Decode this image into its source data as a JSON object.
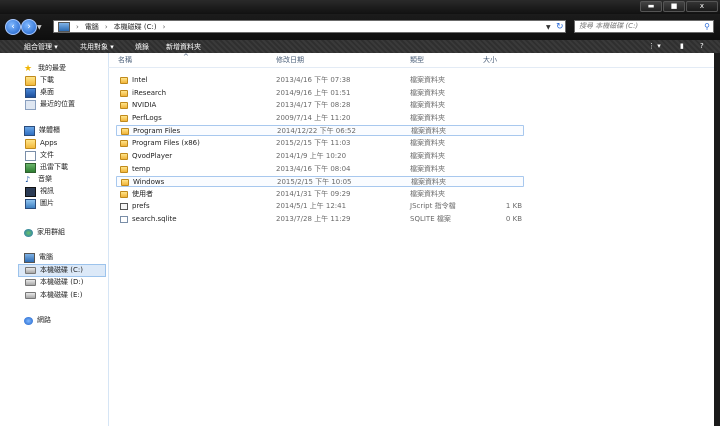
{
  "window": {
    "minimize": "▬",
    "maximize": "■",
    "close": "x"
  },
  "nav": {
    "back": "‹",
    "forward": "›",
    "breadcrumb": [
      "電腦",
      "本機磁碟 (C:)"
    ],
    "search_placeholder": "搜尋 本機磁碟 (C:)"
  },
  "toolbar": {
    "organize": "組合管理 ▾",
    "share": "共用對象 ▾",
    "burn": "燒錄",
    "new_folder": "新增資料夾"
  },
  "sidebar": {
    "favorites": {
      "label": "我的最愛",
      "items": [
        "下載",
        "桌面",
        "最近的位置"
      ]
    },
    "libraries": {
      "label": "媒體櫃",
      "items": [
        "Apps",
        "文件",
        "迅雷下載",
        "音樂",
        "視訊",
        "圖片"
      ]
    },
    "homegroup": "家用群組",
    "computer": {
      "label": "電腦",
      "items": [
        "本機磁碟 (C:)",
        "本機磁碟 (D:)",
        "本機磁碟 (E:)"
      ]
    },
    "network": "網路"
  },
  "columns": {
    "name": "名稱",
    "date": "修改日期",
    "type": "類型",
    "size": "大小"
  },
  "files": [
    {
      "name": "Intel",
      "date": "2013/4/16 下午 07:38",
      "type": "檔案資料夾",
      "size": ""
    },
    {
      "name": "iResearch",
      "date": "2014/9/16 上午 01:51",
      "type": "檔案資料夾",
      "size": ""
    },
    {
      "name": "NVIDIA",
      "date": "2013/4/17 下午 08:28",
      "type": "檔案資料夾",
      "size": ""
    },
    {
      "name": "PerfLogs",
      "date": "2009/7/14 上午 11:20",
      "type": "檔案資料夾",
      "size": ""
    },
    {
      "name": "Program Files",
      "date": "2014/12/22 下午 06:52",
      "type": "檔案資料夾",
      "size": ""
    },
    {
      "name": "Program Files (x86)",
      "date": "2015/2/15 下午 11:03",
      "type": "檔案資料夾",
      "size": ""
    },
    {
      "name": "QvodPlayer",
      "date": "2014/1/9 上午 10:20",
      "type": "檔案資料夾",
      "size": ""
    },
    {
      "name": "temp",
      "date": "2013/4/16 下午 08:04",
      "type": "檔案資料夾",
      "size": ""
    },
    {
      "name": "Windows",
      "date": "2015/2/15 下午 10:05",
      "type": "檔案資料夾",
      "size": ""
    },
    {
      "name": "使用者",
      "date": "2014/1/31 下午 09:29",
      "type": "檔案資料夾",
      "size": ""
    },
    {
      "name": "prefs",
      "date": "2014/5/1 上午 12:41",
      "type": "JScript 指令檔",
      "size": "1 KB"
    },
    {
      "name": "search.sqlite",
      "date": "2013/7/28 上午 11:29",
      "type": "SQLITE 檔案",
      "size": "0 KB"
    }
  ]
}
